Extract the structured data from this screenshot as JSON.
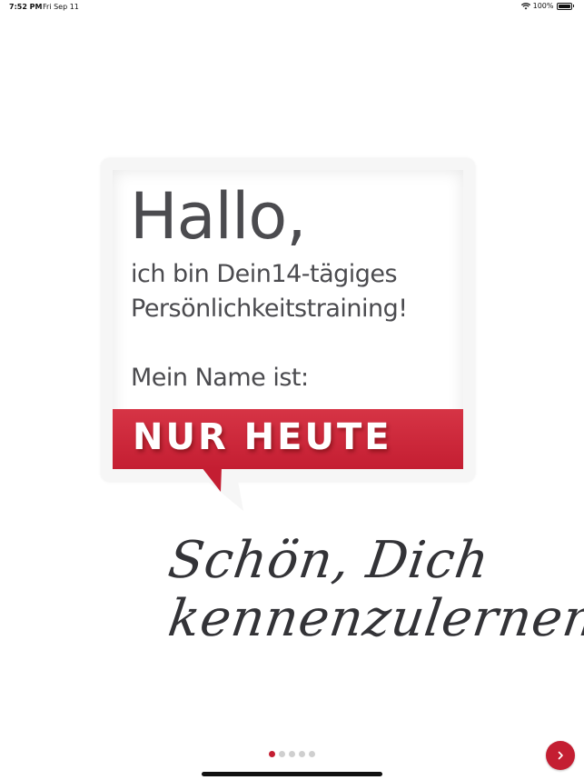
{
  "status": {
    "time": "7:52 PM",
    "date": "Fri Sep 11",
    "battery_pct": "100%"
  },
  "card": {
    "hallo": "Hallo,",
    "line1": "ich bin Dein14-tägiges",
    "line2": "Persönlichkeitstraining!",
    "name_label": "Mein Name ist:",
    "banner": "NUR HEUTE"
  },
  "greeting": {
    "line1": "Schön, Dich",
    "line2": "kennenzulernen!"
  },
  "pager": {
    "current_page": 1,
    "total_pages": 5
  },
  "colors": {
    "accent": "#c41e32",
    "text": "#4b4b4f"
  },
  "icons": {
    "next": "chevron-right-icon",
    "wifi": "wifi-icon",
    "battery": "battery-icon"
  }
}
